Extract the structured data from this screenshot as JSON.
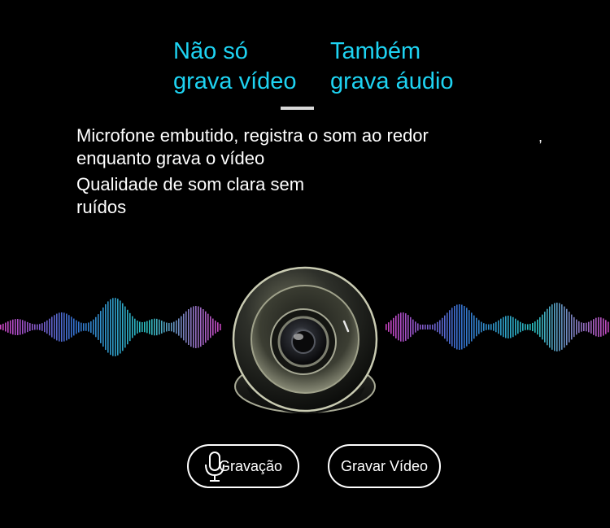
{
  "headline": {
    "left": [
      "Não só",
      "grava vídeo"
    ],
    "right": [
      "Também",
      "grava áudio"
    ],
    "color": "#1ed3f2"
  },
  "description": {
    "line1": "Microfone embutido, registra o som ao redor",
    "line2": "enquanto grava o vídeo",
    "line3": "Qualidade de som clara sem",
    "line4": "ruídos",
    "stray_comma": ","
  },
  "buttons": {
    "recording_label": "Gravação",
    "video_label": "Gravar Vídeo"
  },
  "icons": {
    "microphone": "microphone-icon",
    "camera": "dome-camera-icon",
    "waves": "sound-wave-icon"
  },
  "colors": {
    "wave_magenta": "#e34bd8",
    "wave_cyan": "#2fd6d6",
    "wave_blue": "#3b7ee8"
  }
}
